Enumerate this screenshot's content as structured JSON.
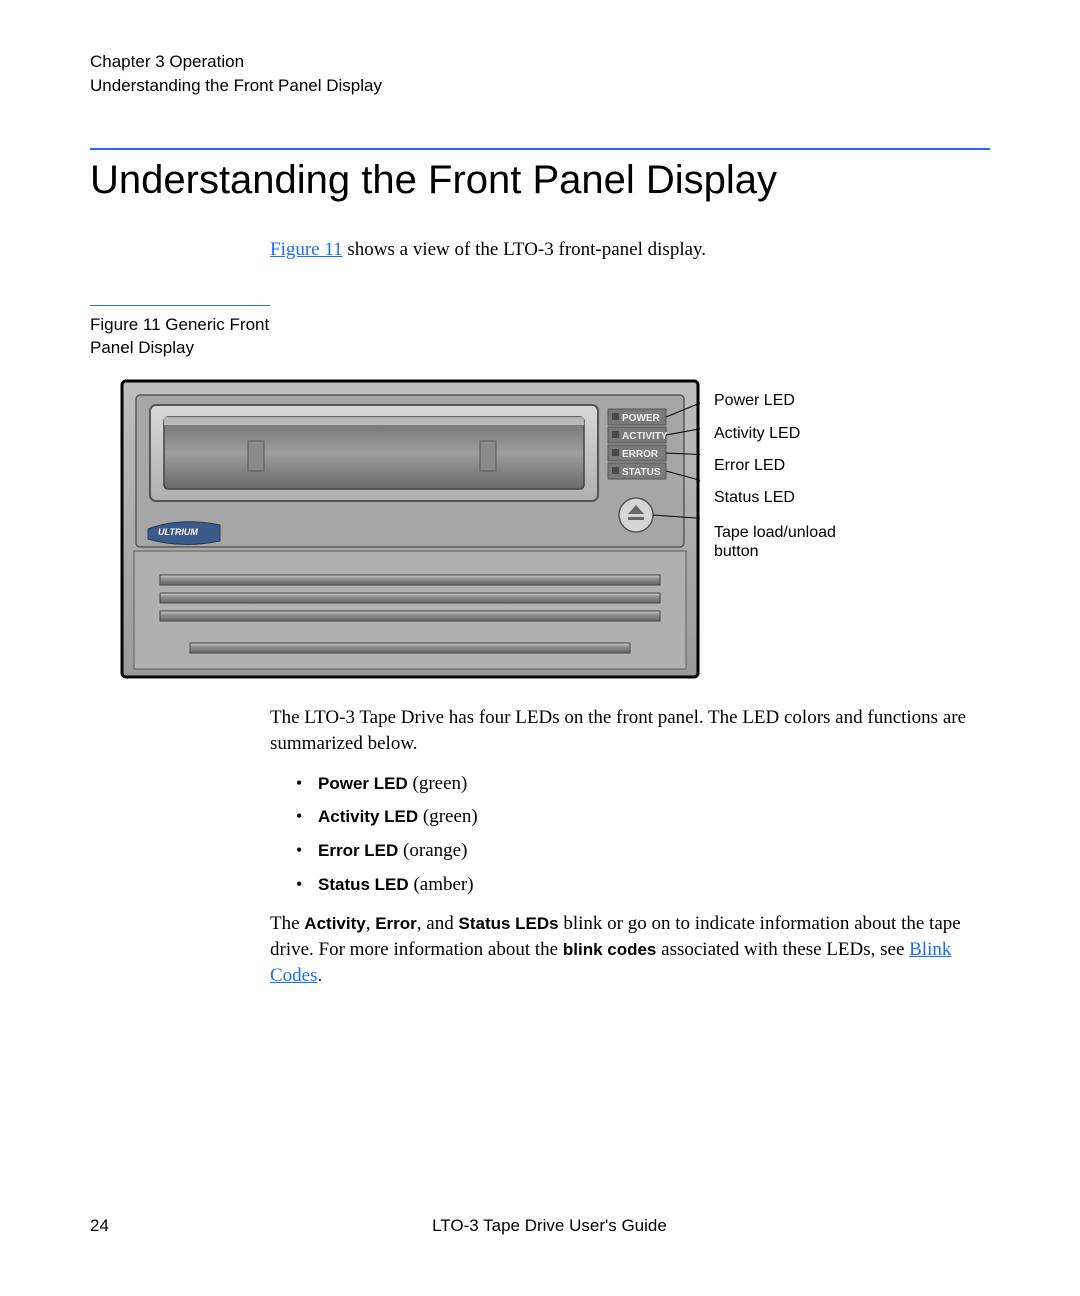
{
  "header": {
    "chapter": "Chapter 3  Operation",
    "section_small": "Understanding the Front Panel Display"
  },
  "title": "Understanding the Front Panel Display",
  "intro_link": "Figure 11",
  "intro_rest": " shows a view of the LTO-3 front-panel display.",
  "caption": "Figure 11  Generic Front Panel Display",
  "labels": {
    "power": "Power LED",
    "activity": "Activity LED",
    "error": "Error LED",
    "status": "Status LED",
    "button": "Tape load/unload button"
  },
  "panel_labels": {
    "power": "POWER",
    "activity": "ACTIVITY",
    "error": "ERROR",
    "status": "STATUS",
    "brand": "ULTRIUM"
  },
  "body": {
    "p1": "The LTO-3 Tape Drive has four LEDs on the front panel. The LED colors and functions are summarized below.",
    "leds": [
      {
        "name": "Power LED",
        "color": "(green)"
      },
      {
        "name": "Activity LED",
        "color": "(green)"
      },
      {
        "name": "Error LED",
        "color": "(orange)"
      },
      {
        "name": "Status LED",
        "color": "(amber)"
      }
    ],
    "p2_a": "The ",
    "p2_b": "Activity",
    "p2_c": ", ",
    "p2_d": "Error",
    "p2_e": ", and ",
    "p2_f": "Status LEDs",
    "p2_g": " blink or go on to indicate information about the tape drive. For more information about the ",
    "p2_h": "blink codes",
    "p2_i": " associated with these LEDs, see ",
    "p2_link": "Blink Codes",
    "p2_j": "."
  },
  "footer": {
    "page": "24",
    "title": "LTO-3 Tape Drive User's Guide"
  }
}
